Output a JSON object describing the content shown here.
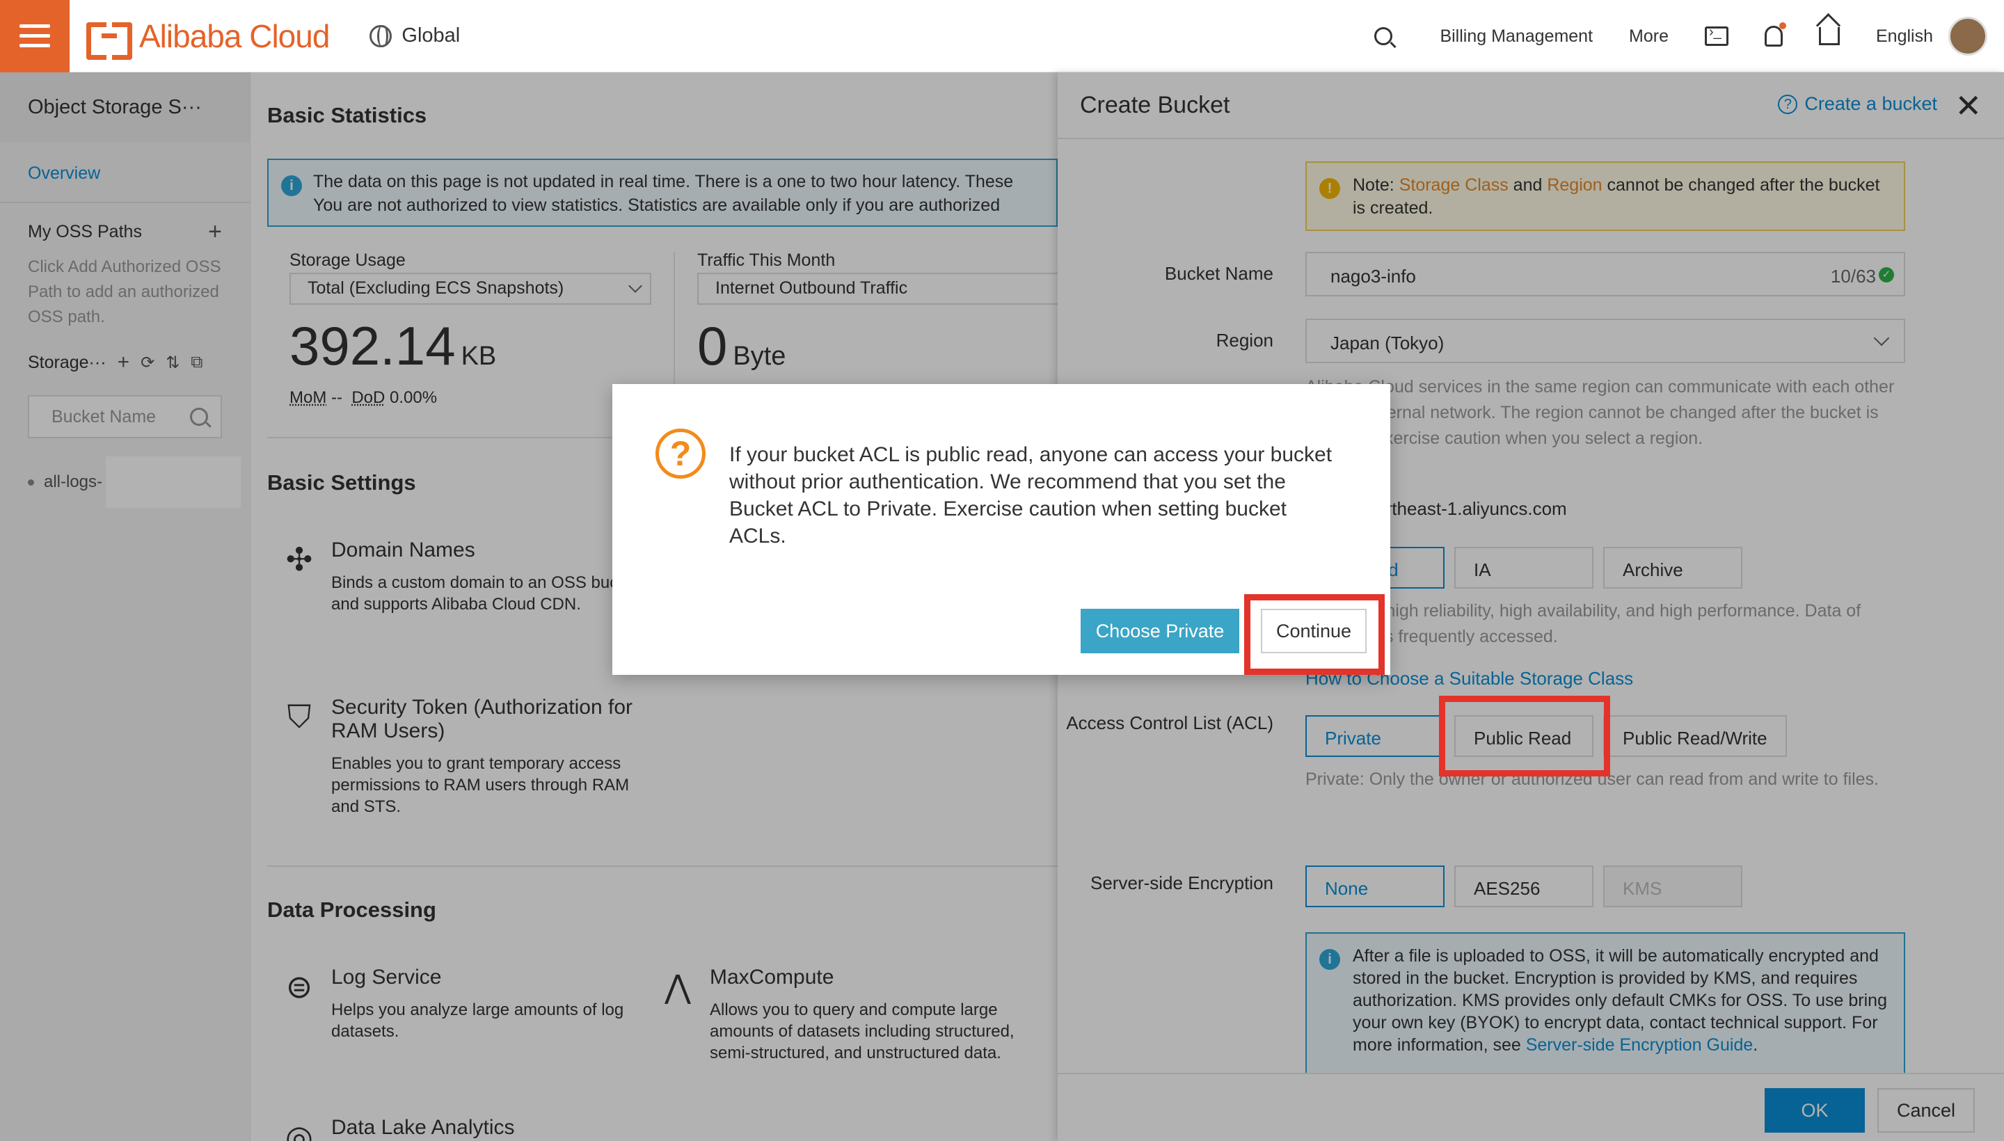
{
  "topbar": {
    "brand": "Alibaba Cloud",
    "region": "Global",
    "billing": "Billing Management",
    "more": "More",
    "language": "English"
  },
  "sidebar": {
    "title": "Object Storage S···",
    "overview": "Overview",
    "my_paths": "My OSS Paths",
    "help": "Click Add Authorized OSS Path to add an authorized OSS path.",
    "storage": "Storage···",
    "search_placeholder": "Bucket Name",
    "bucket": "all-logs-"
  },
  "main": {
    "basic_statistics": "Basic Statistics",
    "info_line1": "The data on this page is not updated in real time. There is a one to two hour latency. These",
    "info_line2": "You are not authorized to view statistics. Statistics are available only if you are authorized",
    "storage_usage_label": "Storage Usage",
    "storage_usage_select": "Total (Excluding ECS Snapshots)",
    "storage_value": "392.14",
    "storage_unit": "KB",
    "mom_label": "MoM",
    "mom_value": "--",
    "dod_label": "DoD",
    "dod_value": "0.00%",
    "traffic_label": "Traffic This Month",
    "traffic_select": "Internet Outbound Traffic",
    "traffic_value": "0",
    "traffic_unit": "Byte",
    "basic_settings": "Basic Settings",
    "domain_title": "Domain Names",
    "domain_desc": "Binds a custom domain to an OSS bucket and supports Alibaba Cloud CDN.",
    "sts_title": "Security Token (Authorization for RAM Users)",
    "sts_desc": "Enables you to grant temporary access permissions to RAM users through RAM and STS.",
    "data_processing": "Data Processing",
    "log_title": "Log Service",
    "log_desc": "Helps you analyze large amounts of log datasets.",
    "maxcompute_title": "MaxCompute",
    "maxcompute_desc": "Allows you to query and compute large amounts of datasets including structured, semi-structured, and unstructured data.",
    "dla_title": "Data Lake Analytics"
  },
  "drawer": {
    "title": "Create Bucket",
    "help_link": "Create a bucket",
    "note_prefix": "Note: ",
    "note_storage_class": "Storage Class",
    "note_and": " and ",
    "note_region": "Region",
    "note_suffix": " cannot be changed after the bucket is created.",
    "bucket_name_label": "Bucket Name",
    "bucket_name_value": "nago3-info",
    "bucket_name_count": "10/63",
    "region_label": "Region",
    "region_value": "Japan (Tokyo)",
    "region_desc": "Alibaba Cloud services in the same region can communicate with each other over an internal network. The region cannot be changed after the bucket is created. Exercise caution when you select a region.",
    "endpoint": "oss-ap-northeast-1.aliyuncs.com",
    "storage_class_options": [
      "Standard",
      "IA",
      "Archive"
    ],
    "storage_class_desc": "Standard: high reliability, high availability, and high performance. Data of Standard is frequently accessed.",
    "storage_class_link": "How to Choose a Suitable Storage Class",
    "acl_label": "Access Control List (ACL)",
    "acl_options": [
      "Private",
      "Public Read",
      "Public Read/Write"
    ],
    "acl_desc": "Private: Only the owner or authorized user can read from and write to files.",
    "sse_label": "Server-side Encryption",
    "sse_options": [
      "None",
      "AES256",
      "KMS"
    ],
    "sse_info": "After a file is uploaded to OSS, it will be automatically encrypted and stored in the bucket. Encryption is provided by KMS, and requires authorization. KMS provides only default CMKs for OSS. To use bring your own key (BYOK) to encrypt data, contact technical support. For more information, see ",
    "sse_link": "Server-side Encryption Guide",
    "ok": "OK",
    "cancel": "Cancel"
  },
  "dialog": {
    "message": "If your bucket ACL is public read, anyone can access your bucket without prior authentication. We recommend that you set the Bucket ACL to Private. Exercise caution when setting bucket ACLs.",
    "choose_private": "Choose Private",
    "continue": "Continue"
  },
  "colors": {
    "brand_orange": "#e4632a",
    "link_blue": "#0b8fd6",
    "highlight_red": "#e4332a",
    "warning_orange": "#f28b1c"
  }
}
